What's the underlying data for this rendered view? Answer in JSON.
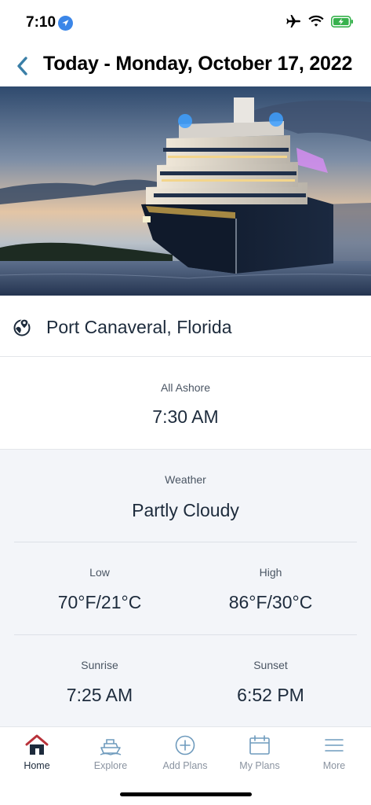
{
  "status_bar": {
    "time": "7:10",
    "icons": [
      "location-arrow-icon",
      "airplane-mode-icon",
      "wifi-icon",
      "battery-charging-icon"
    ]
  },
  "header": {
    "title": "Today - Monday, October 17, 2022",
    "back_icon": "chevron-left-icon"
  },
  "hero": {
    "image": "cruise-ship-at-dusk"
  },
  "port": {
    "icon": "globe-location-icon",
    "name": "Port Canaveral, Florida"
  },
  "all_ashore": {
    "label": "All Ashore",
    "value": "7:30 AM"
  },
  "weather": {
    "label": "Weather",
    "value": "Partly Cloudy",
    "low": {
      "label": "Low",
      "value": "70°F/21°C"
    },
    "high": {
      "label": "High",
      "value": "86°F/30°C"
    },
    "sunrise": {
      "label": "Sunrise",
      "value": "7:25 AM"
    },
    "sunset": {
      "label": "Sunset",
      "value": "6:52 PM"
    }
  },
  "tabbar": {
    "items": [
      {
        "label": "Home",
        "icon": "home-icon",
        "active": true
      },
      {
        "label": "Explore",
        "icon": "ship-icon",
        "active": false
      },
      {
        "label": "Add Plans",
        "icon": "plus-circle-icon",
        "active": false
      },
      {
        "label": "My Plans",
        "icon": "calendar-icon",
        "active": false
      },
      {
        "label": "More",
        "icon": "menu-icon",
        "active": false
      }
    ]
  },
  "colors": {
    "accent": "#3a7fa7",
    "text": "#1d2b3c",
    "home_roof": "#b8323a",
    "weather_bg": "#f3f5f9"
  }
}
